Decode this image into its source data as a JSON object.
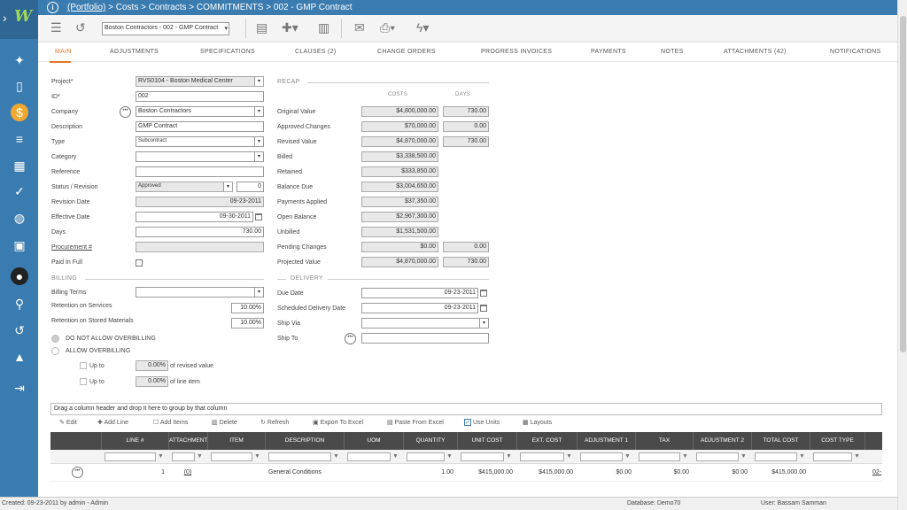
{
  "titlebar": {
    "portfolio_link": "(Portfolio)",
    "breadcrumb_rest": " > Costs > Contracts > COMMITMENTS > 002 - GMP Contract"
  },
  "toolbar": {
    "record_select": "Boston Contractors - 002 - GMP Contract"
  },
  "tabs": [
    "MAIN",
    "ADJUSTMENTS",
    "SPECIFICATIONS",
    "CLAUSES (2)",
    "CHANGE ORDERS",
    "PROGRESS INVOICES",
    "PAYMENTS",
    "NOTES",
    "ATTACHMENTS (42)",
    "NOTIFICATIONS"
  ],
  "form": {
    "project_label": "Project*",
    "project_value": "RVS0104 - Boston Medical Center",
    "id_label": "ID*",
    "id_value": "002",
    "company_label": "Company",
    "company_value": "Boston Contractors",
    "description_label": "Description",
    "description_value": "GMP Contract",
    "type_label": "Type",
    "type_value": "Subcontract",
    "category_label": "Category",
    "category_value": "",
    "reference_label": "Reference",
    "reference_value": "",
    "status_label": "Status / Revision",
    "status_value": "Approved",
    "revision_value": "0",
    "revision_date_label": "Revision Date",
    "revision_date_value": "09-23-2011",
    "effective_date_label": "Effective Date",
    "effective_date_value": "09-30-2011",
    "days_label": "Days",
    "days_value": "730.00",
    "procurement_label": "Procurement #",
    "procurement_value": "",
    "paid_in_full_label": "Paid In Full",
    "billing_section": "BILLING",
    "billing_terms_label": "Billing Terms",
    "billing_terms_value": "",
    "retention_services_label": "Retention on Services",
    "retention_services_value": "10.00%",
    "retention_materials_label": "Retention on Stored Materials",
    "retention_materials_value": "10.00%",
    "no_overbilling_label": "DO NOT ALLOW OVERBILLING",
    "allow_overbilling_label": "ALLOW OVERBILLING",
    "up_to_label_1": "Up to",
    "up_to_value_1": "0.00%",
    "up_to_suffix_1": "of revised value",
    "up_to_label_2": "Up to",
    "up_to_value_2": "0.00%",
    "up_to_suffix_2": "of line item"
  },
  "recap": {
    "section": "RECAP",
    "costs_header": "COSTS",
    "days_header": "DAYS",
    "rows": [
      {
        "label": "Original Value",
        "cost": "$4,800,000.00",
        "days": "730.00"
      },
      {
        "label": "Approved Changes",
        "cost": "$70,000.00",
        "days": "0.00"
      },
      {
        "label": "Revised Value",
        "cost": "$4,870,000.00",
        "days": "730.00"
      },
      {
        "label": "Billed",
        "cost": "$3,338,500.00",
        "days": null
      },
      {
        "label": "Retained",
        "cost": "$333,850.00",
        "days": null
      },
      {
        "label": "Balance Due",
        "cost": "$3,004,650.00",
        "days": null
      },
      {
        "label": "Payments Applied",
        "cost": "$37,350.00",
        "days": null
      },
      {
        "label": "Open Balance",
        "cost": "$2,967,300.00",
        "days": null
      },
      {
        "label": "Unbilled",
        "cost": "$1,531,500.00",
        "days": null
      },
      {
        "label": "Pending Changes",
        "cost": "$0.00",
        "days": "0.00"
      },
      {
        "label": "Projected Value",
        "cost": "$4,870,000.00",
        "days": "730.00"
      }
    ]
  },
  "delivery": {
    "section": "DELIVERY",
    "due_date_label": "Due Date",
    "due_date_value": "09-23-2011",
    "scheduled_label": "Scheduled Delivery Date",
    "scheduled_value": "09-23-2011",
    "ship_via_label": "Ship Via",
    "ship_via_value": "",
    "ship_to_label": "Ship To",
    "ship_to_value": ""
  },
  "grid": {
    "group_hint": "Drag a column header and drop it here to group by that column",
    "toolbar": [
      "Edit",
      "Add Line",
      "Add Items",
      "Delete",
      "Refresh",
      "Export To Excel",
      "Paste From Excel",
      "Use Units",
      "Layouts"
    ],
    "columns": [
      "LINE #",
      "ATTACHMENTS",
      "ITEM",
      "DESCRIPTION",
      "UOM",
      "QUANTITY",
      "UNIT COST",
      "EXT. COST",
      "ADJUSTMENT 1",
      "TAX",
      "ADJUSTMENT 2",
      "TOTAL COST",
      "COST TYPE"
    ],
    "rows": [
      {
        "line": "1",
        "attachments": "(0)",
        "item": "",
        "description": "General Conditions",
        "uom": "",
        "quantity": "1.00",
        "unit_cost": "$415,000.00",
        "ext_cost": "$415,000.00",
        "adj1": "$0.00",
        "tax": "$0.00",
        "adj2": "$0.00",
        "total": "$415,000.00",
        "cost_type": "",
        "extra": "02-"
      }
    ]
  },
  "status": {
    "created": "Created:  09-23-2011 by admin - Admin",
    "database": "Database:   Demo70",
    "user": "User:  Bassam Samman"
  }
}
